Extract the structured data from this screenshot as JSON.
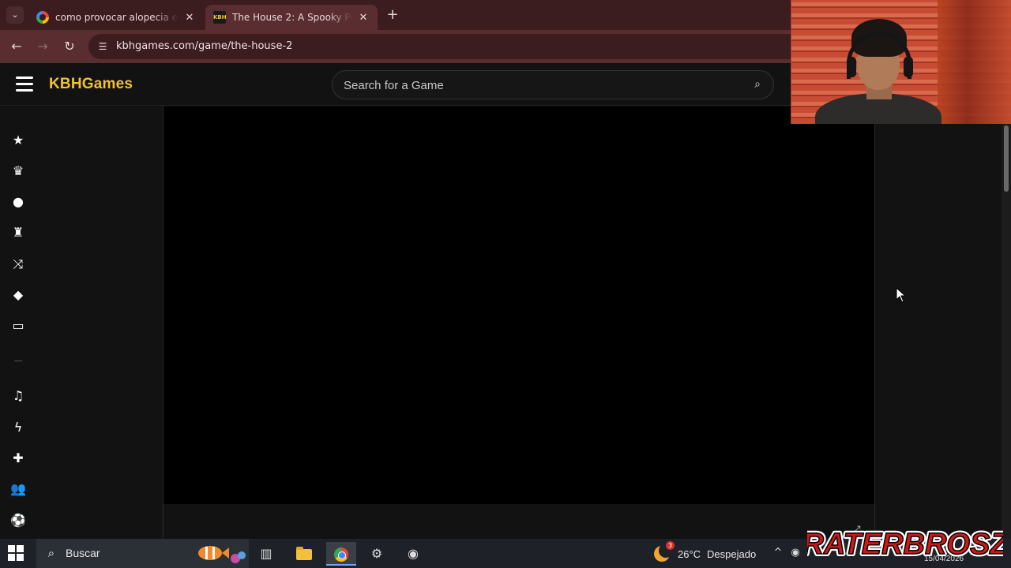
{
  "browser": {
    "tabs": [
      {
        "title": "como provocar alopecia en mi",
        "active": false
      },
      {
        "title": "The House 2: A Spooky Point-a",
        "active": true
      }
    ],
    "url": "kbhgames.com/game/the-house-2",
    "kbh_favicon_text": "KBH"
  },
  "site": {
    "logo": "KBHGames",
    "search_placeholder": "Search for a Game",
    "sidebar_icons": [
      "star-icon",
      "crown-icon",
      "fire-icon",
      "trophy-icon",
      "shuffle-icon",
      "tags-icon",
      "desktop-icon",
      "music-icon",
      "lightning-icon",
      "puzzle-icon",
      "users-icon",
      "soccer-ball-icon"
    ]
  },
  "taskbar": {
    "search_label": "Buscar",
    "weather_temp": "26°C",
    "weather_desc": "Despejado",
    "weather_badge": "3",
    "clock_date": "15/04/2026"
  },
  "watermark": {
    "text": "RATERBROSZ"
  },
  "colors": {
    "brand": "#f2c230",
    "chrome_frame": "#3b1c1f",
    "chrome_toolbar": "#5a2e31",
    "page_bg": "#121212",
    "game_bg": "#000000"
  }
}
